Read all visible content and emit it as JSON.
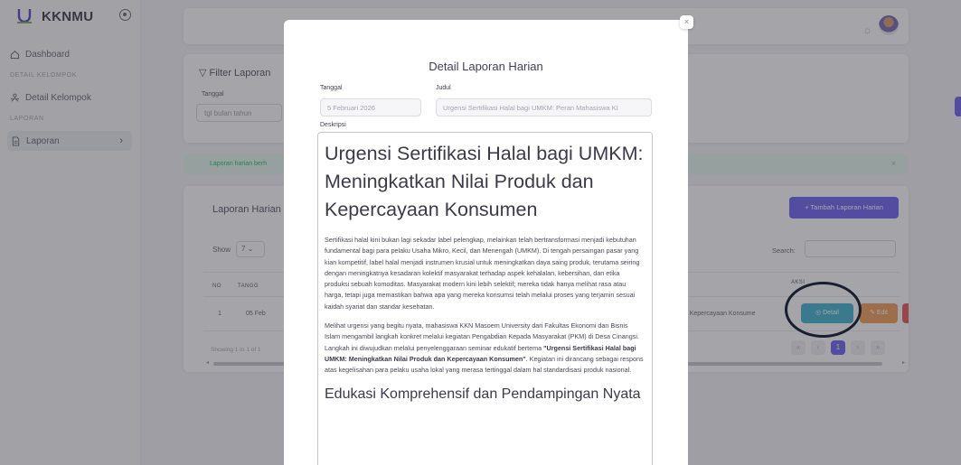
{
  "app": {
    "name": "KKNMU"
  },
  "sidebar": {
    "dashboard": "Dashboard",
    "section_kelompok": "DETAIL KELOMPOK",
    "detail_kelompok": "Detail Kelompok",
    "section_laporan": "LAPORAN",
    "laporan": "Laporan"
  },
  "filter": {
    "title": "Filter Laporan",
    "tanggal_label": "Tanggal",
    "tanggal_placeholder": "tgl bulan tahun"
  },
  "alert": {
    "text": "Laporan harian berh"
  },
  "table": {
    "title": "Laporan Harian",
    "add_button": "+ Tambah Laporan Harian",
    "show_label": "Show",
    "show_value": "7",
    "search_label": "Search:",
    "headers": {
      "no": "NO",
      "tanggal": "TANGG",
      "aksi": "AKSI"
    },
    "rows": [
      {
        "no": "1",
        "tanggal": "05 Feb",
        "judul": "an Kepercayaan Konsume"
      }
    ],
    "detail_button": "Detail",
    "edit_button": "Edit",
    "showing": "Showing 1 to 1 of 1",
    "pager": {
      "first": "«",
      "prev": "‹",
      "current": "1",
      "next": "›",
      "last": "»"
    }
  },
  "modal": {
    "title": "Detail Laporan Harian",
    "tanggal_label": "Tanggal",
    "tanggal_value": "5 Februari 2026",
    "judul_label": "Judul",
    "judul_value": "Urgensi Sertifikasi Halal bagi UMKM: Peran Mahasiswa KI",
    "deskripsi_label": "Deskripsi",
    "close": "×",
    "content": {
      "heading": "Urgensi Sertifikasi Halal bagi UMKM: Meningkatkan Nilai Produk dan Kepercayaan Konsumen",
      "p1": "Sertifikasi halal kini bukan lagi sekadar label pelengkap, melainkan telah bertransformasi menjadi kebutuhan fundamental bagi para pelaku Usaha Mikro, Kecil, dan Menengah (UMKM). Di tengah persaingan pasar yang kian kompetitif, label halal menjadi instrumen krusial untuk meningkatkan daya saing produk, terutama seiring dengan meningkatnya kesadaran kolektif masyarakat terhadap aspek kehalalan, kebersihan, dan etika produksi sebuah komoditas. Masyarakat modern kini lebih selektif; mereka tidak hanya melihat rasa atau harga, tetapi juga memastikan bahwa apa yang mereka konsumsi telah melalui proses yang terjamin sesuai kaidah syariat dan standar kesehatan.",
      "p2_a": "Melihat urgensi yang begitu nyata, mahasiswa KKN Masoem University dari Fakultas Ekonomi dan Bisnis Islam mengambil langkah konkret melalui kegiatan Pengabdian Kepada Masyarakat (PKM) di Desa Cinangsi. Langkah ini diwujudkan melalui penyelenggaraan seminar edukatif bertema ",
      "p2_b": "\"Urgensi Sertifikasi Halal bagi UMKM: Meningkatkan Nilai Produk dan Kepercayaan Konsumen\"",
      "p2_c": ". Kegiatan ini dirancang sebagai respons atas kegelisahan para pelaku usaha lokal yang merasa tertinggal dalam hal standardisasi produk nasional.",
      "heading2": "Edukasi Komprehensif dan Pendampingan Nyata"
    }
  }
}
